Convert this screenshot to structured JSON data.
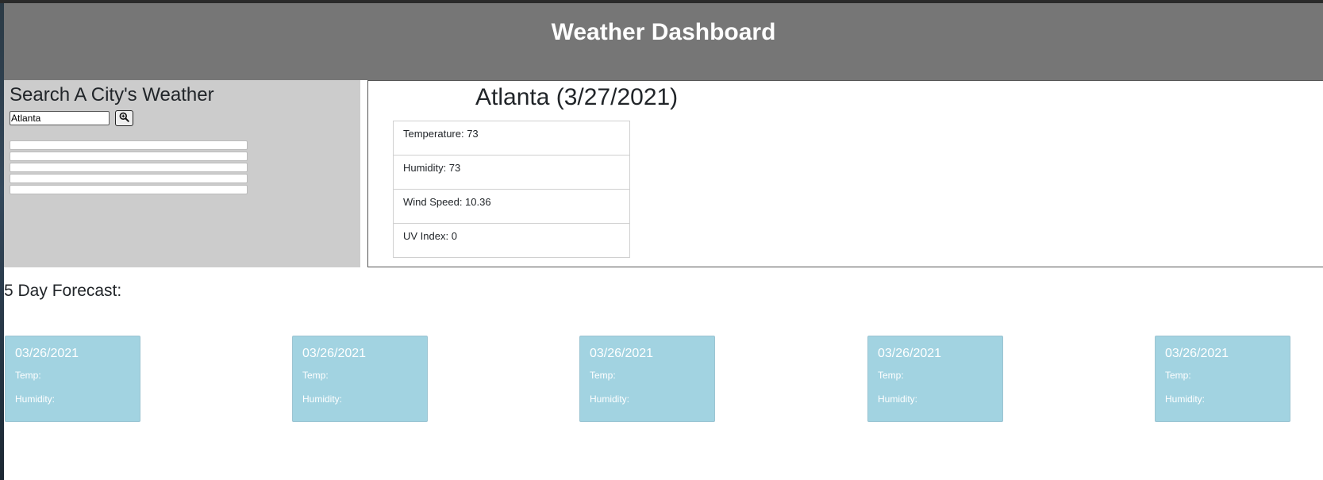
{
  "header": {
    "title": "Weather Dashboard"
  },
  "search": {
    "title": "Search A City's Weather",
    "input_value": "Atlanta",
    "button_icon": "magnifier-icon",
    "history_items": [
      "",
      "",
      "",
      "",
      ""
    ]
  },
  "current": {
    "title": "Atlanta (3/27/2021)",
    "temperature": "Temperature: 73",
    "humidity": "Humidity: 73",
    "wind_speed": "Wind Speed: 10.36",
    "uv_index": "UV Index: 0"
  },
  "forecast": {
    "heading": "5 Day Forecast:",
    "days": [
      {
        "date": "03/26/2021",
        "temp": "Temp:",
        "humidity": "Humidity:"
      },
      {
        "date": "03/26/2021",
        "temp": "Temp:",
        "humidity": "Humidity:"
      },
      {
        "date": "03/26/2021",
        "temp": "Temp:",
        "humidity": "Humidity:"
      },
      {
        "date": "03/26/2021",
        "temp": "Temp:",
        "humidity": "Humidity:"
      },
      {
        "date": "03/26/2021",
        "temp": "Temp:",
        "humidity": "Humidity:"
      }
    ]
  },
  "colors": {
    "header_bg": "#767676",
    "search_panel_bg": "#cccccc",
    "forecast_card_bg": "#a2d3e1"
  }
}
